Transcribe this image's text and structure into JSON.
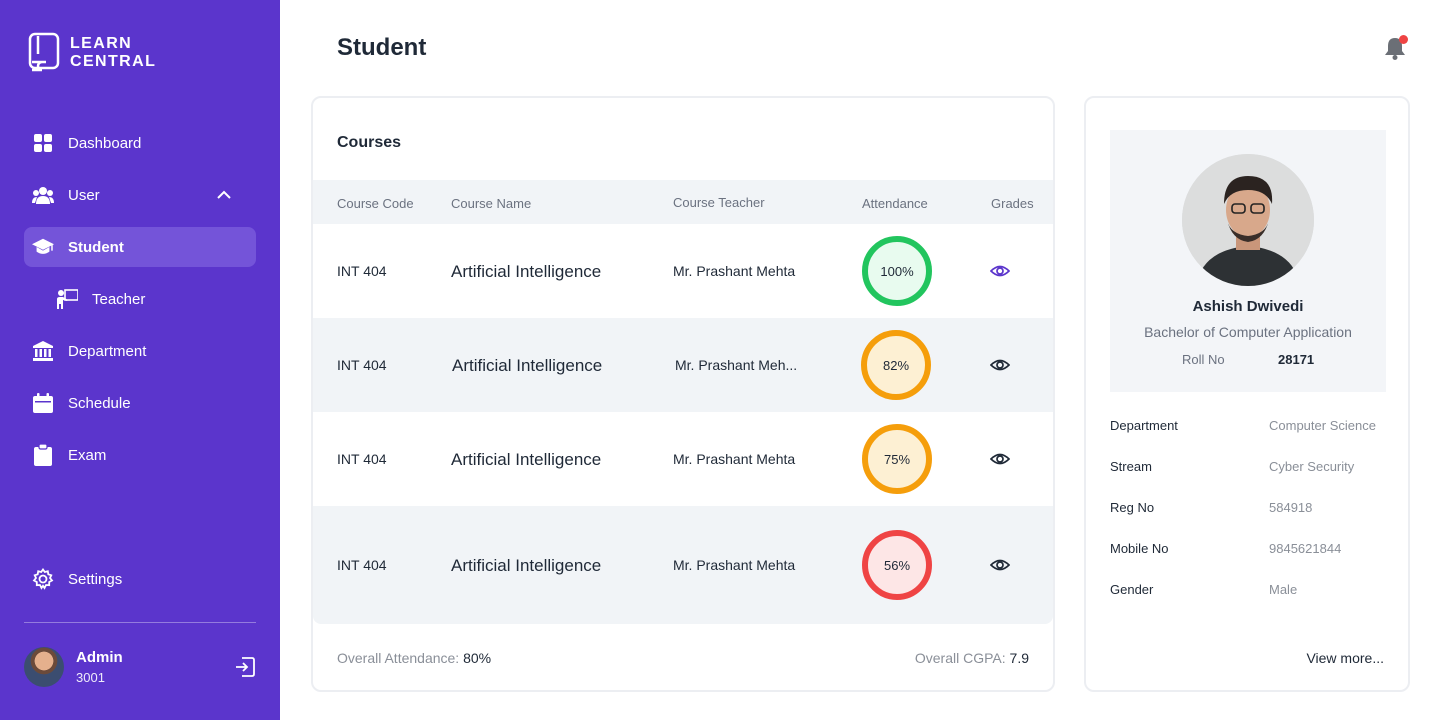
{
  "brand": {
    "line1": "LEARN",
    "line2": "CENTRAL"
  },
  "sidebar": {
    "items": [
      {
        "label": "Dashboard",
        "icon": "grid-icon"
      },
      {
        "label": "User",
        "icon": "users-icon"
      },
      {
        "label": "Student",
        "icon": "graduation-cap-icon"
      },
      {
        "label": "Teacher",
        "icon": "teacher-icon"
      },
      {
        "label": "Department",
        "icon": "building-icon"
      },
      {
        "label": "Schedule",
        "icon": "calendar-icon"
      },
      {
        "label": "Exam",
        "icon": "clipboard-icon"
      }
    ],
    "settings": "Settings",
    "user": {
      "name": "Admin",
      "id": "3001"
    }
  },
  "header": {
    "title": "Student"
  },
  "courses": {
    "title": "Courses",
    "columns": [
      "Course Code",
      "Course Name",
      "Course Teacher",
      "Attendance",
      "Grades"
    ],
    "rows": [
      {
        "code": "INT 404",
        "name": "Artificial Intelligence",
        "teacher": "Mr. Prashant Mehta",
        "attendance": "100%",
        "status_color": "#22c55e"
      },
      {
        "code": "INT 404",
        "name": "Artificial Intelligence",
        "teacher": "Mr. Prashant Meh...",
        "attendance": "82%",
        "status_color": "#f59e0b"
      },
      {
        "code": "INT 404",
        "name": "Artificial Intelligence",
        "teacher": "Mr. Prashant Mehta",
        "attendance": "75%",
        "status_color": "#f59e0b"
      },
      {
        "code": "INT 404",
        "name": "Artificial Intelligence",
        "teacher": "Mr. Prashant Mehta",
        "attendance": "56%",
        "status_color": "#ef4444"
      }
    ],
    "overall_attendance_label": "Overall Attendance:",
    "overall_attendance": "80%",
    "overall_cgpa_label": "Overall CGPA:",
    "overall_cgpa": "7.9"
  },
  "profile": {
    "name": "Ashish Dwivedi",
    "degree": "Bachelor of Computer Application",
    "roll_label": "Roll No",
    "roll": "28171",
    "fields": [
      {
        "label": "Department",
        "value": "Computer Science"
      },
      {
        "label": "Stream",
        "value": "Cyber Security"
      },
      {
        "label": "Reg No",
        "value": "584918"
      },
      {
        "label": "Mobile No",
        "value": "9845621844"
      },
      {
        "label": "Gender",
        "value": "Male"
      }
    ],
    "view_more": "View more..."
  },
  "colors": {
    "sidebar": "#5b35cc",
    "active": "#7454d9",
    "notification": "#ef4444"
  }
}
